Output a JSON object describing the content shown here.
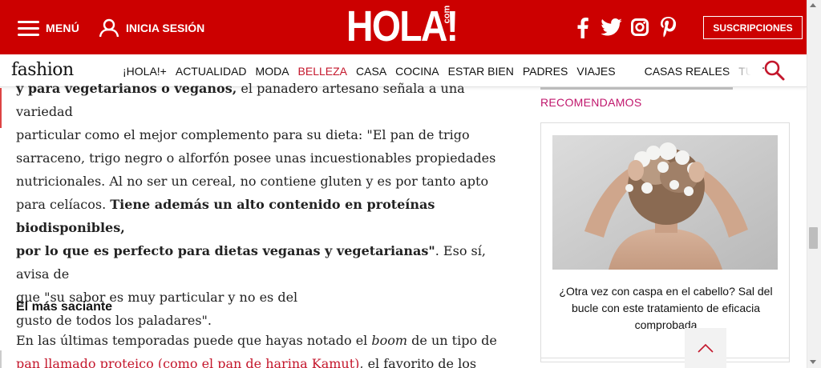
{
  "header": {
    "menu_label": "MENÚ",
    "login_label": "INICIA SESIÓN",
    "logo_text": "HOLA!",
    "logo_suffix": "com",
    "social_icons": [
      "facebook-icon",
      "twitter-icon",
      "instagram-icon",
      "pinterest-icon"
    ],
    "subscriptions_label": "SUSCRIPCIONES",
    "brand_color": "#cc0000"
  },
  "nav": {
    "section_logo": "fashion",
    "items": [
      {
        "label": "¡HOLA!+",
        "active": false
      },
      {
        "label": "ACTUALIDAD",
        "active": false
      },
      {
        "label": "MODA",
        "active": false
      },
      {
        "label": "BELLEZA",
        "active": true
      },
      {
        "label": "CASA",
        "active": false
      },
      {
        "label": "COCINA",
        "active": false
      },
      {
        "label": "ESTAR BIEN",
        "active": false
      },
      {
        "label": "PADRES",
        "active": false
      },
      {
        "label": "VIAJES",
        "active": false
      },
      {
        "label": "CASAS REALES",
        "active": false
      },
      {
        "label": "TUOTRODIA",
        "active": false
      }
    ],
    "active_color": "#c4172c"
  },
  "article": {
    "para1_cut": "y para vegetarianos o veganos,",
    "para1_cut_rest": " el panadero artesano señala a una variedad",
    "para1_lines": [
      "particular como el mejor complemento para su dieta: \"El pan de trigo",
      "sarraceno, trigo negro o alforfón posee unas incuestionables propiedades",
      "nutricionales. Al no ser un cereal, no contiene gluten y es por tanto apto"
    ],
    "para1_l5_a": "para celíacos. ",
    "para1_l5_bold": "Tiene además un alto contenido en proteínas biodisponibles,",
    "para1_l6_bold": "por lo que es perfecto para dietas veganas y vegetarianas\"",
    "para1_l6_rest": ". Eso sí, avisa de",
    "para1_l7": "que \"su sabor es muy particular y no es del",
    "para1_l8": "gusto de todos los paladares\".",
    "subheading": "El más saciante",
    "para2_a": "En las últimas temporadas puede que hayas notado el ",
    "para2_italic": "boom",
    "para2_b": " de un tipo de",
    "para2_link": "pan llamado proteico (como el pan de harina Kamut)",
    "para2_c": ", el favorito de los"
  },
  "sidebar": {
    "title": "RECOMENDAMOS",
    "card_title": "¿Otra vez con caspa en el cabello? Sal del bucle con este tratamiento de eficacia comprobada",
    "title_color": "#c0166c"
  },
  "back_to_top_icon": "chevron-up-icon"
}
